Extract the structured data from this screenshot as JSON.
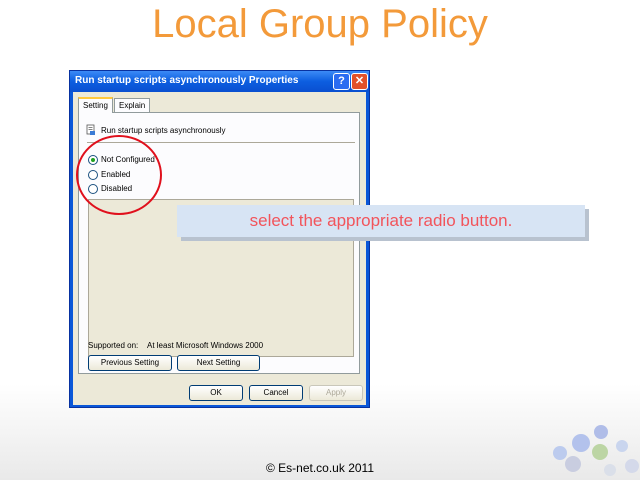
{
  "slide": {
    "title": "Local Group Policy",
    "callout": "select the appropriate radio button.",
    "footer": "© Es-net.co.uk 2011"
  },
  "dialog": {
    "title": "Run startup scripts asynchronously Properties",
    "help_label": "?",
    "close_label": "✕",
    "tabs": [
      {
        "label": "Setting",
        "active": true
      },
      {
        "label": "Explain",
        "active": false
      }
    ],
    "policy_name": "Run startup scripts asynchronously",
    "options": [
      {
        "label": "Not Configured",
        "checked": true
      },
      {
        "label": "Enabled",
        "checked": false
      },
      {
        "label": "Disabled",
        "checked": false
      }
    ],
    "supported_label": "Supported on:",
    "supported_value": "At least Microsoft Windows 2000",
    "previous_button": "Previous Setting",
    "next_button": "Next Setting",
    "ok_button": "OK",
    "cancel_button": "Cancel",
    "apply_button": "Apply"
  },
  "colors": {
    "title": "#f39a3a",
    "callout_text": "#f2545b",
    "highlight_circle": "#e0101c",
    "titlebar": "#0c5ee0"
  }
}
